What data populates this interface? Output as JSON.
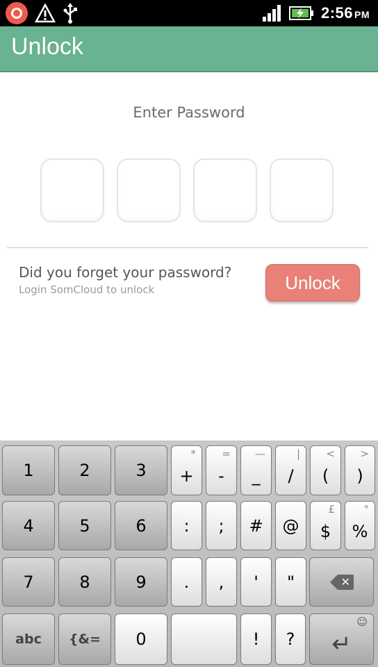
{
  "status_bar": {
    "time": "2:56",
    "ampm": "PM",
    "icons": [
      "app-notification-icon",
      "warning-icon",
      "usb-icon",
      "signal-icon",
      "battery-charging-icon"
    ]
  },
  "app_bar": {
    "title": "Unlock"
  },
  "content": {
    "enter_password_label": "Enter Password",
    "forgot_title": "Did you forget your password?",
    "forgot_subtitle": "Login SomCloud to unlock",
    "unlock_button": "Unlock"
  },
  "keyboard": {
    "row1": [
      {
        "main": "1",
        "alt": ""
      },
      {
        "main": "2",
        "alt": ""
      },
      {
        "main": "3",
        "alt": ""
      },
      {
        "main": "+",
        "alt": "*"
      },
      {
        "main": "-",
        "alt": "="
      },
      {
        "main": "_",
        "alt": "—"
      },
      {
        "main": "/",
        "alt": "|"
      },
      {
        "main": "(",
        "alt": "<"
      },
      {
        "main": ")",
        "alt": ">"
      }
    ],
    "row2": [
      {
        "main": "4",
        "alt": ""
      },
      {
        "main": "5",
        "alt": ""
      },
      {
        "main": "6",
        "alt": ""
      },
      {
        "main": ":",
        "alt": ""
      },
      {
        "main": ";",
        "alt": ""
      },
      {
        "main": "#",
        "alt": ""
      },
      {
        "main": "@",
        "alt": ""
      },
      {
        "main": "$",
        "alt": "£"
      },
      {
        "main": "%",
        "alt": "°"
      }
    ],
    "row3": [
      {
        "main": "7",
        "alt": ""
      },
      {
        "main": "8",
        "alt": ""
      },
      {
        "main": "9",
        "alt": ""
      },
      {
        "main": ".",
        "alt": ""
      },
      {
        "main": ",",
        "alt": ""
      },
      {
        "main": "'",
        "alt": ""
      },
      {
        "main": "\"",
        "alt": ""
      }
    ],
    "row4": {
      "abc": "abc",
      "symbols": "{&=",
      "zero": "0",
      "space": "",
      "exclaim": "!",
      "question": "?",
      "enter_alt": "☺"
    }
  }
}
